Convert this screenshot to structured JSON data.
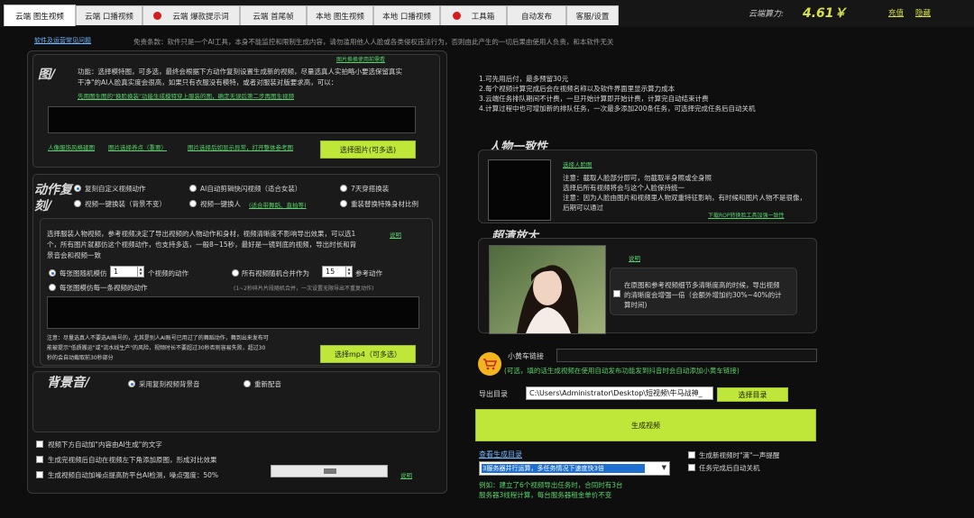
{
  "tabs": [
    {
      "label": "云端 图生视频",
      "active": true
    },
    {
      "label": "云端 口播视频"
    },
    {
      "label": "云端 爆款提示词",
      "icon": true
    },
    {
      "label": "云端 首尾帧"
    },
    {
      "label": "本地 图生视频"
    },
    {
      "label": "本地 口播视频"
    },
    {
      "label": "工具箱",
      "icon": true
    },
    {
      "label": "自动发布"
    },
    {
      "label": "客服/设置"
    }
  ],
  "topbar": {
    "power_label": "云端算力:",
    "power_value": "4.61￥",
    "recharge": "充值",
    "hide": "隐藏"
  },
  "notice": {
    "faq_link": "软件及运营常见问题",
    "disclaimer": "免责条款：软件只是一个AI工具，本身不能监控和限制生成内容，请勿滥用他人人脸或各类侵权违法行为，否则由此产生的一切后果由使用人负责，和本软件无关"
  },
  "image_section": {
    "title": "图/",
    "top_link": "图片换换使用前需看",
    "description_1": "功能：选择模特图，可多选，最终会根据下方动作复刻设置生成新的视频，尽量选真人实拍略小要选保留真实",
    "description_2": "干净\"的AI人脸真实度会很高，如果只有衣服没有模特，或者对服装对版要求高，可以：",
    "description_link": "先用图生图的\"换脸换装\"功能生成模特穿上服装的图，确定无误后第二步再图生视频",
    "link_face": "人像服饰风格建图",
    "link_tutorial": "图片选择养点（重要）",
    "link_fix": "图片选择后如显示异常，打开整体参考图",
    "select_button": "选择图片(可多选)"
  },
  "motion_section": {
    "title_1": "动作复",
    "title_2": "刻/",
    "options": [
      {
        "label": "复刻自定义视频动作",
        "selected": true
      },
      {
        "label": "AI自动剪辑快闪视频（适合女装）"
      },
      {
        "label": "7天穿搭换装"
      },
      {
        "label": "视频一键换装（背景不变）"
      },
      {
        "label": "视频一键换人"
      },
      {
        "label": "重装替换特殊身材比例"
      }
    ],
    "option_link": "(适合带舞蹈、直拍等)",
    "desc_1": "选择服装人物视频，参考视频决定了导出视频的人物动作和身材，视频清晰度不影响导出效果，可以选1",
    "desc_2": "个，所有图片就都仿这个视频动作，也支持多选，一般8~15秒，最好是一镜到底的视频，导出时长和背",
    "desc_3": "景音会和视频一致",
    "desc_link": "说明",
    "per_image_pre": "每张图随机模仿",
    "per_image_count": "1",
    "per_image_post": "个视频的动作",
    "merge_pre": "所有视频随机合并作为",
    "merge_count": "15",
    "merge_post": "参考动作",
    "per_image_each": "每张图模仿每一条视频的动作",
    "merge_note": "(1~2秒碎片片段随机合并，一次设置无限导出不重复动作)",
    "note_1": "注意：尽量选真人不要选AI账号的，尤其是别人AI账号已用过了的舞蹈动作，舞到出来发布可",
    "note_2": "能被提示\"低质搬运\"或\"流水线生产\"的风险，视频时长不要超过30秒否则容易失败，超过30",
    "note_3": "秒的会自动截取前30秒部分",
    "select_button": "选择mp4（可多选）"
  },
  "bgm_section": {
    "title": "背景音/",
    "opt_use_original": "采用复刻视频背景音",
    "opt_rematch": "重新配音"
  },
  "checkbox_options": {
    "ai_label": "视频下方自动加\"内容由AI生成\"的文字",
    "compare": "生成完视频后自动在视频左下角添加原图，形成对比效果",
    "mosaic": "生成视频自动加噪点提高防平台AI检测，噪点强度：50%",
    "explain": "说明"
  },
  "info": {
    "line_1": "1.可先用后付，最多预留30元",
    "line_2": "2.每个视频计算完成后会在视频名称以及软件界面里显示算力成本",
    "line_3": "3.云端任务排队期间不计费，一旦开始计算即开始计费，计算完自动结束计费",
    "line_4": "4.计算过程中也可增加新的排队任务，一次最多添加200条任务，可选择完成任务后自动关机"
  },
  "consistency": {
    "title": "人物一致性",
    "select_link": "选择人脸图",
    "note_1": "注意：截取人脸部分即可，勿截取半身照或全身照",
    "note_2": "选择后所有视频将会与这个人脸保持统一",
    "note_3": "注意：因为人脸由图片和视频里人物双重特征影响，有时候和图片人物不是很像，",
    "note_4": "后期可以通过",
    "download_link": "下载ROP转换脸工具加强一致性"
  },
  "upscale": {
    "title": "超清放大",
    "explain": "说明",
    "text_1": "在原图和参考视频细节多清晰度高的时候，导出视频",
    "text_2": "的清晰度会增强一倍（会额外增加约30%~40%的计",
    "text_3": "算时间)"
  },
  "cart": {
    "label": "小黄车链接",
    "note": "(可选，填的话生成视频在使用自动发布功能发到抖音时会自动添加小黄车链接)"
  },
  "export": {
    "label": "导出目录",
    "path": "C:\\Users\\Administrator\\Desktop\\短视频\\牛马战神_",
    "select_button": "选择目录",
    "generate_button": "生成视频"
  },
  "output": {
    "view_link": "查看生成目录",
    "dropdown_value": "3服务器并行运算，多任务情况下速度快3倍",
    "example_1": "例如：建立了6个视频导出任务时，合同时有3台",
    "example_2": "服务器3线程计算，每台服务器租金单价不变",
    "check_sound": "生成新视频时\"滴\"一声提醒",
    "check_shutdown": "任务完成后自动关机"
  },
  "colors": {
    "accent_green": "#bfe73a",
    "power_yellow": "#d9e14a",
    "link_green": "#58d26a",
    "link_blue": "#6fb7ff"
  }
}
